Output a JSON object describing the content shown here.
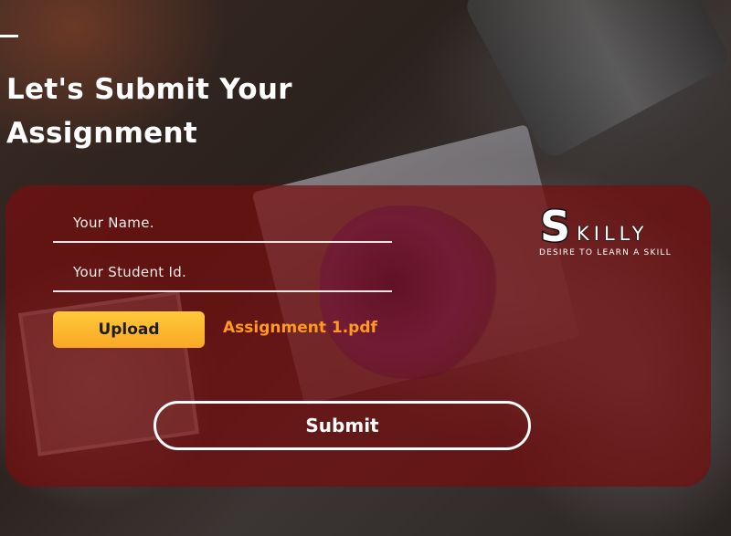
{
  "page": {
    "title": "Let's Submit Your Assignment"
  },
  "form": {
    "name_placeholder": "Your Name.",
    "student_id_placeholder": "Your Student Id.",
    "upload_label": "Upload",
    "file_name": "Assignment 1.pdf",
    "submit_label": "Submit"
  },
  "logo": {
    "letter": "S",
    "word": "KILLY",
    "tagline": "DESIRE TO LEARN A SKILL"
  },
  "colors": {
    "card": "#760e0e",
    "upload_button": "#f9a825",
    "file_name": "#ff9a1f",
    "text": "#ffffff"
  }
}
